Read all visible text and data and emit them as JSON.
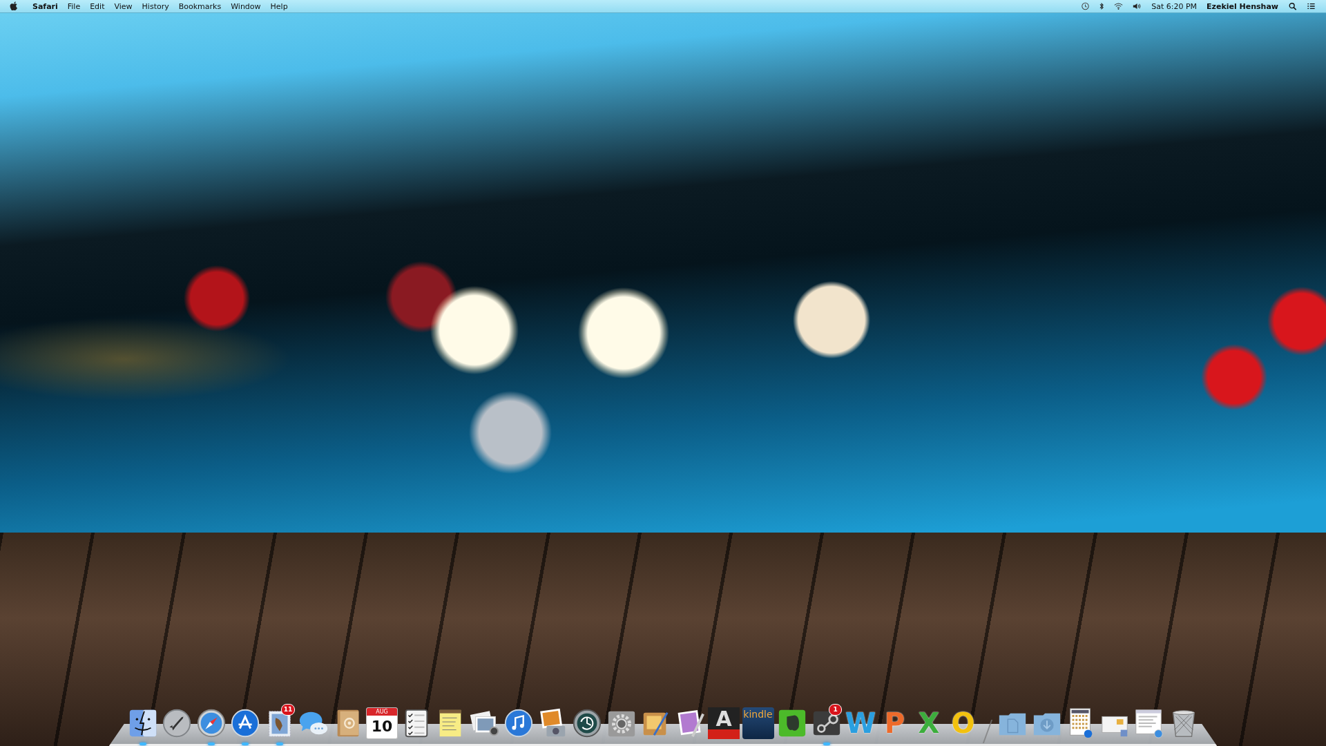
{
  "menu_bar": {
    "app_name": "Safari",
    "menus": [
      "File",
      "Edit",
      "View",
      "History",
      "Bookmarks",
      "Window",
      "Help"
    ],
    "clock": "Sat 6:20 PM",
    "user": "Ezekiel Henshaw"
  },
  "dock": {
    "items": [
      {
        "kind": "finder",
        "running": true
      },
      {
        "kind": "launchpad",
        "running": false
      },
      {
        "kind": "safari",
        "running": true
      },
      {
        "kind": "appstore",
        "running": true
      },
      {
        "kind": "mail",
        "running": true,
        "badge": "11"
      },
      {
        "kind": "messages",
        "running": false
      },
      {
        "kind": "contacts",
        "running": false
      },
      {
        "kind": "calendar",
        "running": false,
        "month": "AUG",
        "day": "10"
      },
      {
        "kind": "reminders",
        "running": false
      },
      {
        "kind": "notes",
        "running": false
      },
      {
        "kind": "preview",
        "running": false
      },
      {
        "kind": "itunes",
        "running": false
      },
      {
        "kind": "iphoto",
        "running": false
      },
      {
        "kind": "timemachine",
        "running": false
      },
      {
        "kind": "sysprefs",
        "running": false
      },
      {
        "kind": "pen-photo",
        "running": false
      },
      {
        "kind": "purple-photo",
        "running": false
      },
      {
        "kind": "letter-3d",
        "running": false,
        "label": "A"
      },
      {
        "kind": "kindle",
        "running": false,
        "label": "kindle"
      },
      {
        "kind": "evernote",
        "running": false
      },
      {
        "kind": "steam",
        "running": true,
        "badge": "1"
      },
      {
        "kind": "letter",
        "running": false,
        "label": "W",
        "color": "#2a9fe0"
      },
      {
        "kind": "letter",
        "running": false,
        "label": "P",
        "color": "#ee6a2a"
      },
      {
        "kind": "letter",
        "running": false,
        "label": "X",
        "color": "#3cae3c"
      },
      {
        "kind": "letter",
        "running": false,
        "label": "O",
        "color": "#f2c10f"
      },
      {
        "kind": "separator"
      },
      {
        "kind": "doc-folder",
        "running": false
      },
      {
        "kind": "download-folder",
        "running": false
      },
      {
        "kind": "window-appstore",
        "running": false
      },
      {
        "kind": "window-preview",
        "running": false
      },
      {
        "kind": "window-safari",
        "running": false
      },
      {
        "kind": "trash",
        "running": false
      }
    ]
  }
}
